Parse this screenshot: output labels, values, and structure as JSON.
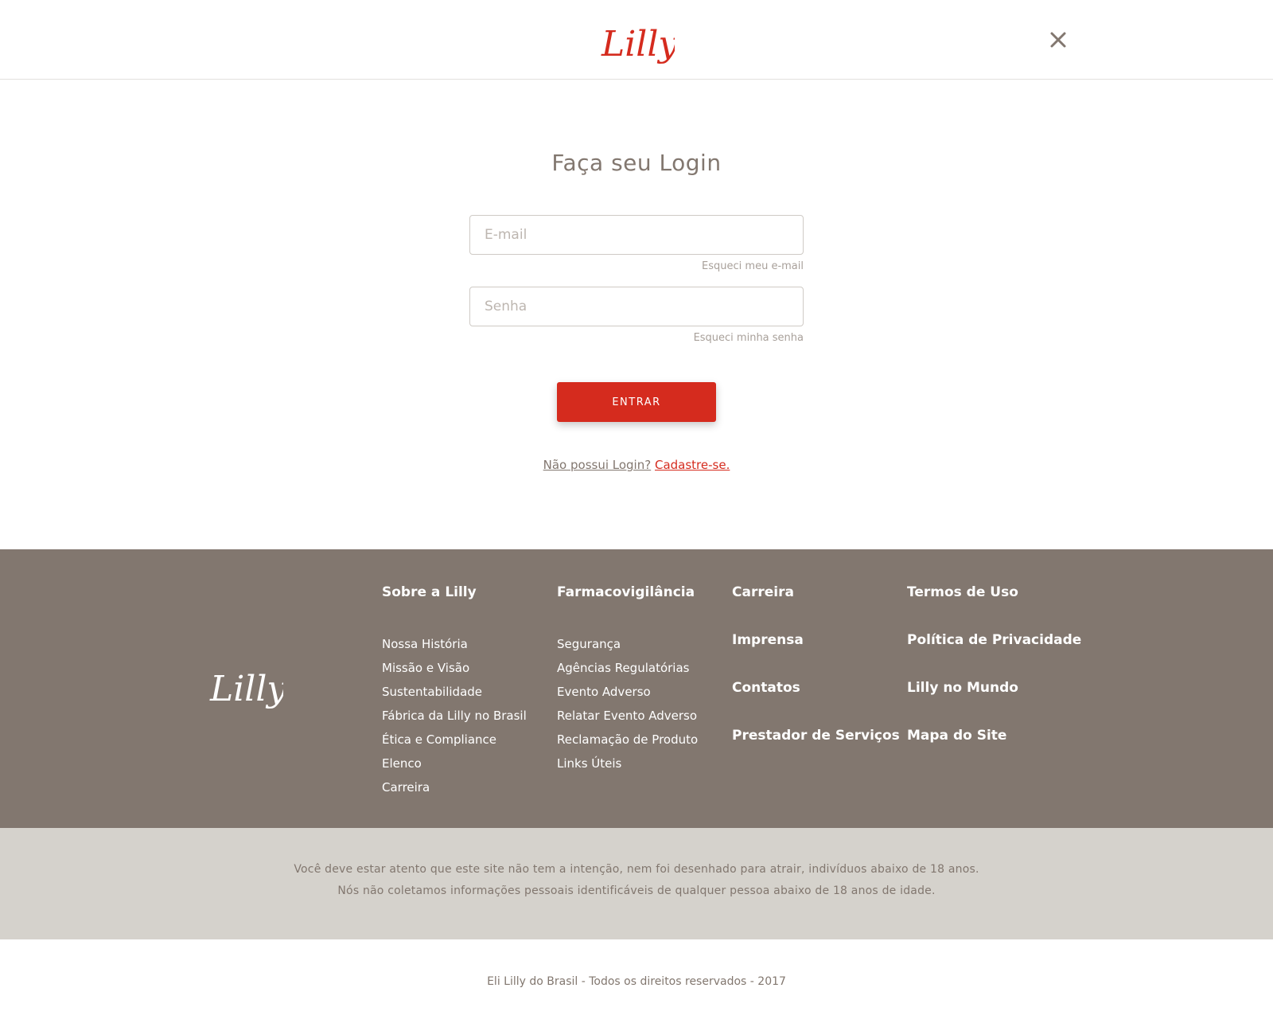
{
  "header": {
    "logo_text": "Lilly",
    "close_icon": "close-icon"
  },
  "login": {
    "title": "Faça seu Login",
    "email_placeholder": "E-mail",
    "forgot_email": "Esqueci meu e-mail",
    "password_placeholder": "Senha",
    "forgot_password": "Esqueci minha senha",
    "submit_label": "ENTRAR",
    "signup_question": "Não possui Login?",
    "signup_link": "Cadastre-se."
  },
  "footer": {
    "logo_text": "Lilly",
    "col1": {
      "heading": "Sobre a Lilly",
      "items": [
        "Nossa História",
        "Missão e Visão",
        "Sustentabilidade",
        "Fábrica da Lilly no Brasil",
        "Ética e Compliance",
        "Elenco",
        "Carreira"
      ]
    },
    "col2": {
      "heading": "Farmacovigilância",
      "items": [
        "Segurança",
        "Agências Regulatórias",
        "Evento Adverso",
        "Relatar Evento Adverso",
        "Reclamação de Produto",
        "Links Úteis"
      ]
    },
    "col3": {
      "items": [
        "Carreira",
        "Imprensa",
        "Contatos",
        "Prestador de Serviços"
      ]
    },
    "col4": {
      "items": [
        "Termos de Uso",
        "Política de Privacidade",
        "Lilly no Mundo",
        "Mapa do Site"
      ]
    }
  },
  "disclaimer": {
    "line1": "Você deve estar atento que este site não tem a intenção, nem foi desenhado para atrair, indivíduos abaixo de 18 anos.",
    "line2": "Nós não coletamos informações pessoais identificáveis de qualquer pessoa abaixo de 18 anos de idade."
  },
  "copyright": "Eli Lilly do Brasil - Todos os direitos reservados - 2017",
  "colors": {
    "brand_red": "#d52b1e",
    "footer_bg": "#82776f",
    "disclaimer_bg": "#d5d2cc"
  }
}
